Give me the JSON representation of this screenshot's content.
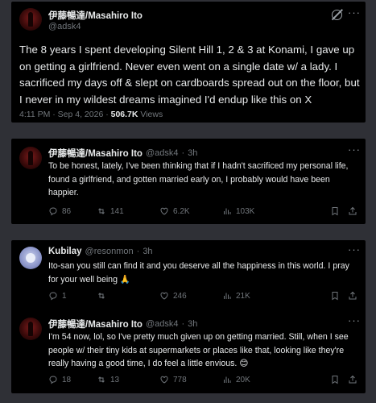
{
  "main_post": {
    "author_name": "伊藤暢達/Masahiro Ito",
    "author_handle": "@adsk4",
    "text": "The 8 years I spent developing Silent Hill 1, 2 & 3 at Konami, I gave up on getting a girlfriend. Never even went on a single date w/ a lady. I sacrificed my days off & slept on cardboards spread out on the floor, but I never in my wildest dreams imagined I'd endup like this on X",
    "time": "4:11 PM · Sep 4, 2026 · ",
    "views_count": "506.7K",
    "views_label": " Views"
  },
  "reply1": {
    "author_name": "伊藤暢達/Masahiro Ito",
    "author_handle": "@adsk4",
    "age": "3h",
    "text": "To be honest, lately, I've been thinking that if I hadn't sacrificed my personal life, found a girlfriend, and gotten married early on, I probably would have been happier.",
    "replies": "86",
    "reposts": "141",
    "likes": "6.2K",
    "views": "103K"
  },
  "reply2": {
    "author_name": "Kubilay",
    "author_handle": "@resonmon",
    "age": "3h",
    "text": "Ito-san you still can find it and you deserve all the happiness in this world. I pray for your well being 🙏",
    "replies": "1",
    "reposts": "",
    "likes": "246",
    "views": "21K"
  },
  "reply3": {
    "author_name": "伊藤暢達/Masahiro Ito",
    "author_handle": "@adsk4",
    "age": "3h",
    "text": "I'm 54 now, lol, so I've pretty much given up on getting married. Still, when I see people w/ their tiny kids at supermarkets or places like that, looking like they're really having a good time, I do feel a little envious. 😊",
    "replies": "18",
    "reposts": "13",
    "likes": "778",
    "views": "20K"
  },
  "icons": [
    "grok-icon",
    "more-icon",
    "reply-icon",
    "repost-icon",
    "like-icon",
    "views-icon",
    "bookmark-icon",
    "share-icon"
  ],
  "colors": {
    "background": "#2f3036",
    "card": "#000000",
    "text": "#e7e9ea",
    "muted": "#71767b"
  }
}
